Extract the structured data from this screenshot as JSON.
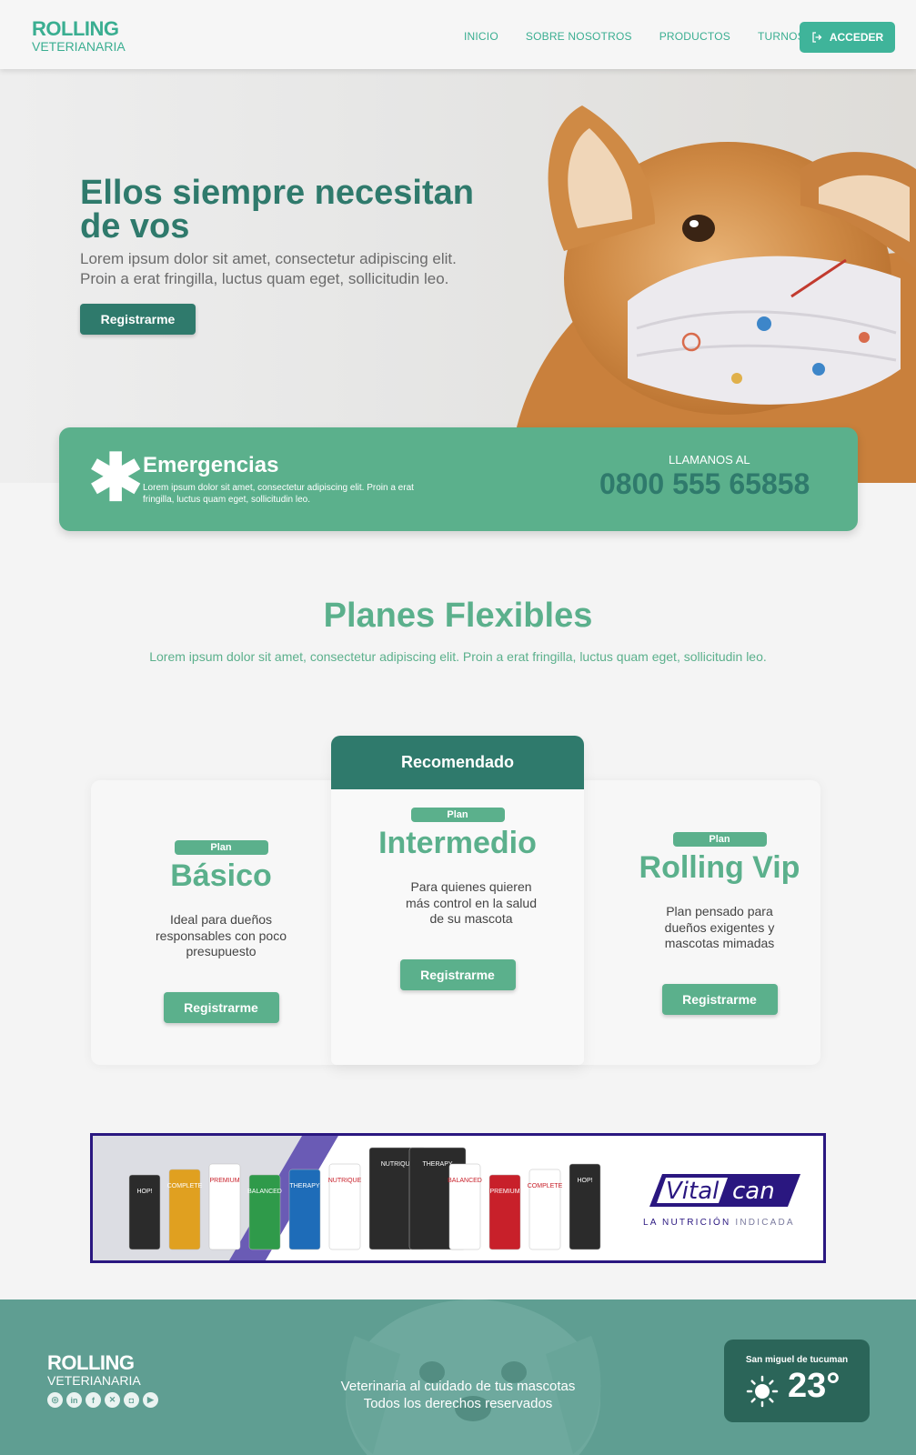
{
  "navbar": {
    "brand_top": "ROLLING",
    "brand_bottom": "VETERIANARIA",
    "links": [
      "INICIO",
      "SOBRE NOSOTROS",
      "PRODUCTOS",
      "TURNOS"
    ],
    "login_label": "ACCEDER",
    "login_icon": "login-icon"
  },
  "hero": {
    "title": "Ellos siempre necesitan de vos",
    "text": "Lorem ipsum dolor sit amet, consectetur adipiscing elit. Proin a erat fringilla, luctus quam eget, sollicitudin leo.",
    "cta": "Registrarme"
  },
  "emergency": {
    "icon": "asterisk-icon",
    "title": "Emergencias",
    "text": "Lorem ipsum dolor sit amet, consectetur adipiscing elit. Proin a erat fringilla, luctus quam eget, sollicitudin leo.",
    "call_label": "LLAMANOS AL",
    "phone": "0800 555 65858"
  },
  "plans": {
    "title": "Planes Flexibles",
    "subtitle": "Lorem ipsum dolor sit amet, consectetur adipiscing elit. Proin a erat fringilla, luctus quam eget, sollicitudin leo.",
    "recommended_label": "Recomendado",
    "items": [
      {
        "badge": "Plan",
        "name": "Básico",
        "desc": "Ideal para dueños responsables con poco presupuesto",
        "cta": "Registrarme"
      },
      {
        "badge": "Plan",
        "name": "Intermedio",
        "desc": "Para quienes quieren más control en la salud de su mascota",
        "cta": "Registrarme"
      },
      {
        "badge": "Plan",
        "name": "Rolling Vip",
        "desc": "Plan pensado para dueños exigentes y mascotas mimadas",
        "cta": "Registrarme"
      }
    ]
  },
  "ad": {
    "brand": "Vitalcan",
    "tagline_main": "LA NUTRICIÓN",
    "tagline_accent": "INDICADA",
    "package_labels": [
      "HOP!",
      "COMPLETE",
      "PREMIUM",
      "BALANCED",
      "THERAPY",
      "NUTRIQUE",
      "NUTRIQUE",
      "THERAPY",
      "BALANCED",
      "PREMIUM",
      "COMPLETE",
      "HOP!"
    ]
  },
  "footer": {
    "brand_top": "ROLLING",
    "brand_bottom": "VETERIANARIA",
    "socials": [
      "whatsapp-icon",
      "linkedin-icon",
      "facebook-icon",
      "x-icon",
      "instagram-icon",
      "youtube-icon"
    ],
    "line1": "Veterinaria al cuidado de tus mascotas",
    "line2": "Todos los derechos reservados",
    "weather": {
      "city": "San miguel de tucuman",
      "temp": "23°",
      "icon": "sun-icon"
    }
  },
  "colors": {
    "accent": "#3aae91",
    "dark_green": "#2f7a6c",
    "emergency_green": "#5bb08c",
    "footer_green": "#5f9e92",
    "ad_border": "#2a1780"
  }
}
